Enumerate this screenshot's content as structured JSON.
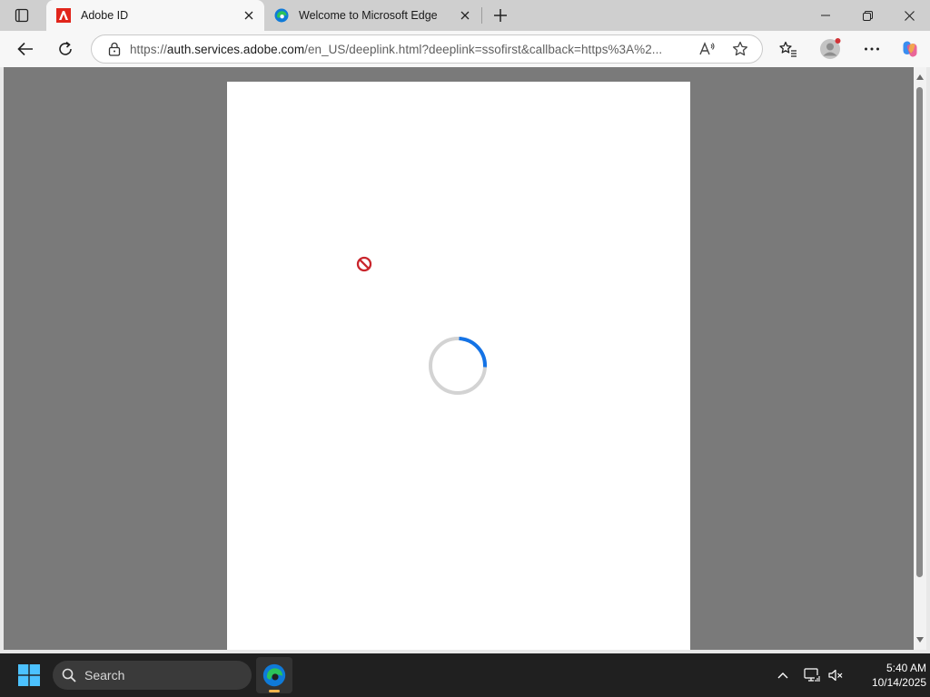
{
  "browser": {
    "tabs": [
      {
        "title": "Adobe ID",
        "active": true
      },
      {
        "title": "Welcome to Microsoft Edge",
        "active": false
      }
    ],
    "address": {
      "url_scheme": "https://",
      "url_host": "auth.services.adobe.com",
      "url_rest": "/en_US/deeplink.html?deeplink=ssofirst&callback=https%3A%2..."
    },
    "icons": {
      "tab_actions": "tab-actions-icon",
      "new_tab": "plus-icon",
      "back": "back-arrow-icon",
      "refresh": "refresh-icon",
      "site_info": "lock-icon",
      "read_aloud": "read-aloud-icon",
      "favorite": "star-icon",
      "favorites_hub": "favorites-icon",
      "profile": "profile-icon",
      "more": "more-icon",
      "copilot": "copilot-icon"
    }
  },
  "page": {
    "state": "loading",
    "blocked_icon": "blocked-icon",
    "spinner_progress": 0.25
  },
  "taskbar": {
    "search_label": "Search",
    "time": "5:40 AM",
    "date": "10/14/2025"
  },
  "colors": {
    "tabstrip": "#cfcfcf",
    "toolbar": "#f7f7f7",
    "viewport": "#7a7a7a",
    "spinner_accent": "#1473e6",
    "blocked_red": "#c9252c",
    "taskbar": "#202020"
  }
}
